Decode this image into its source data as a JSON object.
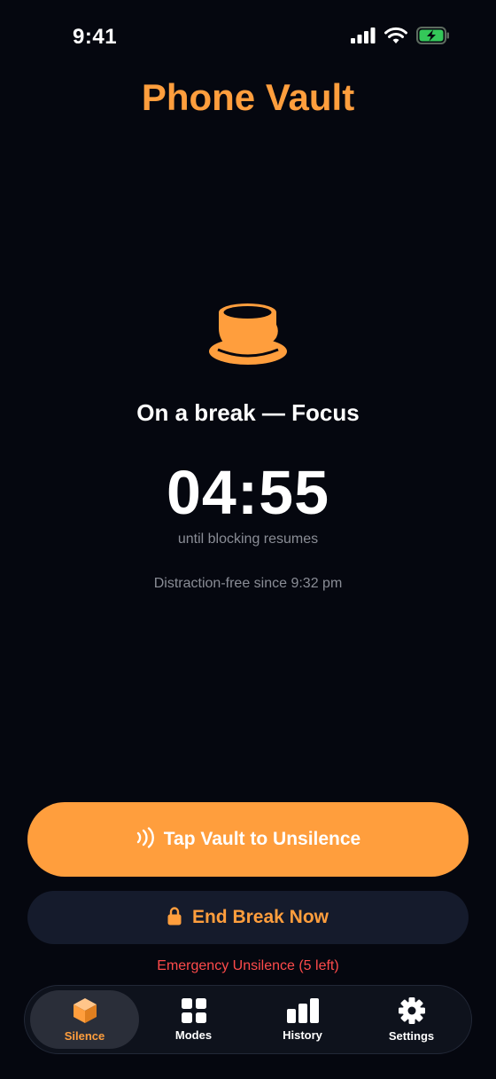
{
  "status_bar": {
    "time": "9:41",
    "icons": [
      "cellular-signal-icon",
      "wifi-icon",
      "battery-charging-icon"
    ]
  },
  "app": {
    "title": "Phone Vault"
  },
  "break_status": {
    "icon": "coffee-cup-icon",
    "label": "On a break — Focus",
    "timer": "04:55",
    "caption": "until blocking resumes",
    "since": "Distraction-free since 9:32 pm"
  },
  "actions": {
    "tap_vault": {
      "label": "Tap Vault to Unsilence",
      "icon": "nfc-icon"
    },
    "end_break": {
      "label": "End Break Now",
      "icon": "lock-icon"
    },
    "emergency": {
      "label": "Emergency Unsilence (5 left)"
    }
  },
  "tabs": [
    {
      "label": "Silence",
      "icon": "box-icon",
      "active": true
    },
    {
      "label": "Modes",
      "icon": "grid-icon",
      "active": false
    },
    {
      "label": "History",
      "icon": "bar-chart-icon",
      "active": false
    },
    {
      "label": "Settings",
      "icon": "gear-icon",
      "active": false
    }
  ],
  "colors": {
    "background": "#05070f",
    "accent": "#ff9e3d",
    "secondary_button": "#151b2c",
    "danger": "#ff4b4b",
    "battery": "#34c759"
  }
}
